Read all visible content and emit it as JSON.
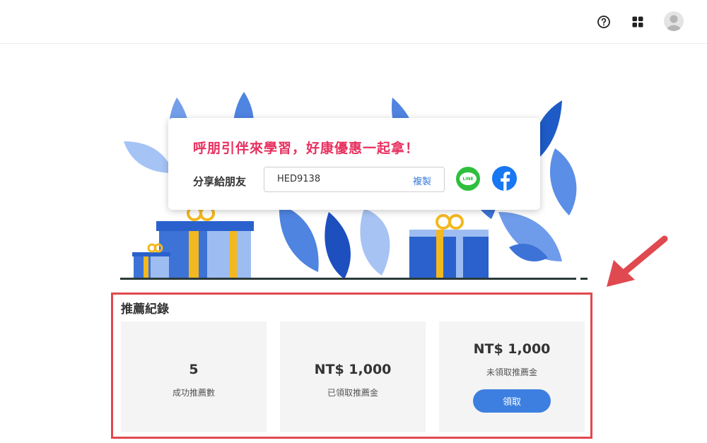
{
  "topbar": {
    "help_icon": "help-circle-icon",
    "apps_icon": "grid-icon",
    "avatar_icon": "user-avatar-icon"
  },
  "share": {
    "headline": "呼朋引伴來學習，好康優惠一起拿！",
    "label": "分享給朋友",
    "code": "HED9138",
    "copy_label": "複製",
    "line_label": "LINE",
    "line_icon": "line-icon",
    "facebook_icon": "facebook-icon"
  },
  "records": {
    "title": "推薦紀錄",
    "cards": [
      {
        "value": "5",
        "label": "成功推薦數"
      },
      {
        "value": "NT$ 1,000",
        "label": "已領取推薦金"
      },
      {
        "value": "NT$ 1,000",
        "label": "未領取推薦金",
        "button": "領取"
      }
    ]
  },
  "colors": {
    "headline": "#e8305f",
    "primary_blue": "#3d7fe0",
    "highlight_border": "#e0494f",
    "card_bg": "#f4f4f4",
    "line_green": "#2fbf3e",
    "facebook_blue": "#1877f2"
  }
}
